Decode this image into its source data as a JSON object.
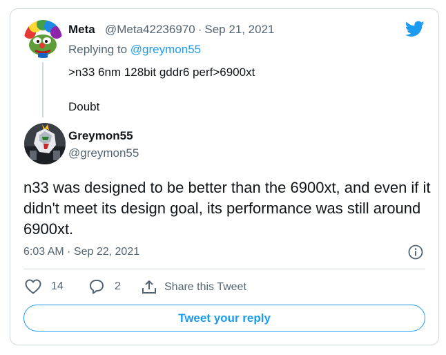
{
  "tweet_parent": {
    "author_name": "Meta",
    "author_handle": "@Meta42236970",
    "date": "Sep 21, 2021",
    "replying_prefix": "Replying to",
    "replying_to": "@greymon55",
    "text": ">n33 6nm 128bit gddr6 perf>6900xt\n\nDoubt",
    "avatar_icon": "pepe-clown-avatar"
  },
  "tweet_main": {
    "author_name": "Greymon55",
    "author_handle": "@greymon55",
    "text": "n33 was designed to be better than the 6900xt, and even if it didn't meet its design goal, its performance was still around 6900xt.",
    "timestamp": "6:03 AM · Sep 22, 2021",
    "avatar_icon": "gundam-avatar"
  },
  "actions": {
    "like_count": "14",
    "reply_count": "2",
    "share_label": "Share this Tweet"
  },
  "reply_button_label": "Tweet your reply",
  "colors": {
    "accent": "#1d9bf0",
    "secondary_text": "#536471",
    "border": "#cfd9de"
  },
  "separator": "·"
}
